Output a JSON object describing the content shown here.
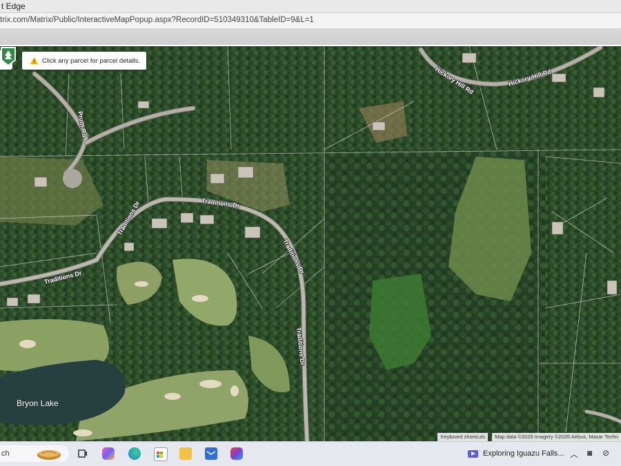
{
  "browser": {
    "title": "t Edge",
    "url": "trix.com/Matrix/Public/InteractiveMapPopup.aspx?RecordID=510349310&TableID=9&L=1"
  },
  "map": {
    "hint": "Click any parcel for parcel details.",
    "roads": {
      "hickory_1": "Hickory Hill Rd",
      "hickory_2": "Hickory Hill Rd",
      "pruitt": "Pruitt Rd",
      "traditions_1": "Traditions Dr",
      "traditions_2": "Traditions Dr",
      "traditions_3": "Traditions Dr",
      "traditions_4": "Traditions Dr",
      "traditions_5": "Traditions Dr"
    },
    "lake": "Bryon Lake",
    "attribution": {
      "shortcuts": "Keyboard shortcuts",
      "data": "Map data ©2026 Imagery ©2026 Airbus, Maxar Techn"
    },
    "icons": {
      "locate": "locate-icon",
      "warning": "warning-icon",
      "marker": "tree-marker-icon"
    }
  },
  "taskbar": {
    "search_text": "ch",
    "now_playing": "Exploring Iguazu Falls...",
    "icons": [
      "task-view-icon",
      "copilot-icon",
      "edge-icon",
      "store-icon",
      "file-explorer-icon",
      "mail-icon",
      "office-icon"
    ],
    "tray_icons": [
      "chevron-up-icon",
      "camera-icon",
      "network-icon"
    ]
  }
}
